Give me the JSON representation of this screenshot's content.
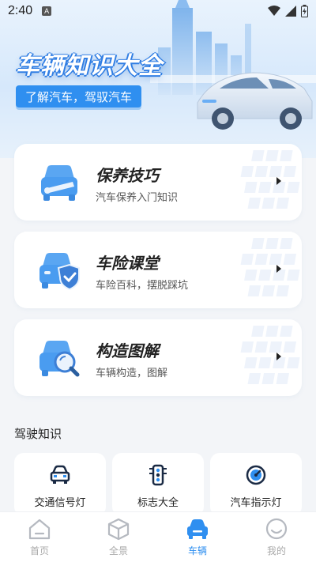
{
  "status_bar": {
    "time": "2:40",
    "badge": "A"
  },
  "hero": {
    "title": "车辆知识大全",
    "tagline": "了解汽车，驾驭汽车"
  },
  "cards": [
    {
      "title": "保养技巧",
      "subtitle": "汽车保养入门知识",
      "icon": "car-wrench-icon"
    },
    {
      "title": "车险课堂",
      "subtitle": "车险百科，摆脱踩坑",
      "icon": "car-shield-check-icon"
    },
    {
      "title": "构造图解",
      "subtitle": "车辆构造，图解",
      "icon": "car-magnifier-icon"
    }
  ],
  "section": {
    "title": "驾驶知识"
  },
  "shortcuts": [
    {
      "label": "交通信号灯",
      "icon": "car-front-icon"
    },
    {
      "label": "标志大全",
      "icon": "traffic-light-icon"
    },
    {
      "label": "汽车指示灯",
      "icon": "gauge-icon"
    }
  ],
  "tabs": [
    {
      "label": "首页",
      "icon": "home-icon",
      "active": false
    },
    {
      "label": "全景",
      "icon": "cube-icon",
      "active": false
    },
    {
      "label": "车辆",
      "icon": "car-icon",
      "active": true
    },
    {
      "label": "我的",
      "icon": "smiley-icon",
      "active": false
    }
  ],
  "colors": {
    "accent": "#2f8ff0",
    "icon_blue": "#4a9cf0",
    "background": "#f3f5f8"
  }
}
